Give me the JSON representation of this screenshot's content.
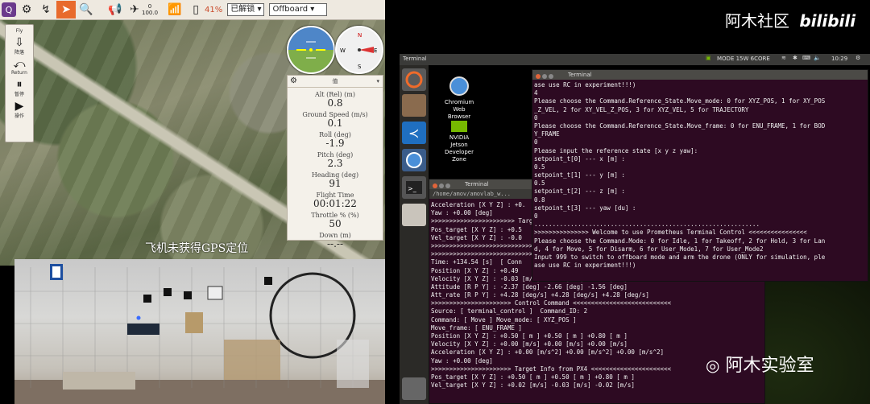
{
  "qgc": {
    "toolbar": {
      "gps_count": "0",
      "hdop": "100.0",
      "battery": "41%",
      "arm_state": "已解锁",
      "flight_mode": "Offboard"
    },
    "fly_tools": [
      {
        "label": "Fly",
        "icon": "plane-icon"
      },
      {
        "label": "降落",
        "icon": "land-icon"
      },
      {
        "label": "Return",
        "icon": "return-icon"
      },
      {
        "label": "暂停",
        "icon": "pause-icon"
      },
      {
        "label": "操作",
        "icon": "action-icon"
      }
    ],
    "values_panel": {
      "header": "值",
      "items": [
        {
          "label": "Alt (Rel) (m)",
          "value": "0.8"
        },
        {
          "label": "Ground Speed (m/s)",
          "value": "0.1"
        },
        {
          "label": "Roll (deg)",
          "value": "-1.9"
        },
        {
          "label": "Pitch (deg)",
          "value": "2.3"
        },
        {
          "label": "Heading (deg)",
          "value": "91"
        },
        {
          "label": "Flight Time",
          "value": "00:01:22"
        },
        {
          "label": "Throttle % (%)",
          "value": "50"
        },
        {
          "label": "Down (m)",
          "value": "--.--"
        }
      ]
    },
    "compass": {
      "n": "N",
      "e": "E",
      "s": "S",
      "w": "W"
    },
    "gps_message": "飞机未获得GPS定位"
  },
  "desktop": {
    "topbar": {
      "title": "Terminal",
      "mode": "MODE 15W 6CORE",
      "time": "10:29"
    },
    "icons": [
      {
        "label": "Chromium\nWeb\nBrowser"
      },
      {
        "label": "NVIDIA\nJetson\nDeveloper\nZone"
      }
    ],
    "small_terminal": {
      "title": "Terminal",
      "path": "/home/amov/amovlab_w...",
      "lines": [
        "Acceleration [X Y Z] : +0.",
        "Yaw : +0.00 [deg]",
        ">>>>>>>>>>>>>>>>>>>>>>> Targ",
        "Pos_target [X Y Z] : +0.5",
        "Vel_target [X Y Z] : -0.0",
        ">>>>>>>>>>>>>>>>>>>>>>>>>>>>",
        ">>>>>>>>>>>>>>>>>>>>>>>>>>>>",
        "Time: +134.54 [s]  [ Conn",
        "Position [X Y Z] : +0.49",
        "Velocity [X Y Z] : -0.03 [m/s] +0.10 [m/s] -0.00 [m/s]",
        "Attitude [R P Y] : -2.37 [deg] -2.66 [deg] -1.56 [deg]",
        "Att_rate [R P Y] : +4.28 [deg/s] +4.28 [deg/s] +4.28 [deg/s]",
        ">>>>>>>>>>>>>>>>>>>>>> Control Command <<<<<<<<<<<<<<<<<<<<<<<<<<<",
        "Source: [ terminal_control ]  Command_ID: 2",
        "Command: [ Move ] Move_mode: [ XYZ_POS ]",
        "Move_frame: [ ENU_FRAME ]",
        "Position [X Y Z] : +0.50 [ m ] +0.50 [ m ] +0.80 [ m ]",
        "Velocity [X Y Z] : +0.00 [m/s] +0.00 [m/s] +0.00 [m/s]",
        "Acceleration [X Y Z] : +0.00 [m/s^2] +0.00 [m/s^2] +0.00 [m/s^2]",
        "Yaw : +0.00 [deg]",
        ">>>>>>>>>>>>>>>>>>>>>> Target Info from PX4 <<<<<<<<<<<<<<<<<<<<<<",
        "Pos_target [X Y Z] : +0.50 [ m ] +0.50 [ m ] +0.80 [ m ]",
        "Vel_target [X Y Z] : +0.02 [m/s] -0.03 [m/s] -0.02 [m/s]"
      ]
    },
    "main_terminal": {
      "title": "Terminal",
      "lines": [
        "ase use RC in experiment!!!)",
        "4",
        "Please choose the Command.Reference_State.Move_mode: 0 for XYZ_POS, 1 for XY_POS",
        "_Z_VEL, 2 for XY_VEL_Z_POS, 3 for XYZ_VEL, 5 for TRAJECTORY",
        "0",
        "Please choose the Command.Reference_State.Move_frame: 0 for ENU_FRAME, 1 for BOD",
        "Y_FRAME",
        "0",
        "Please input the reference state [x y z yaw]:",
        "setpoint_t[0] --- x [m] :",
        "0.5",
        "setpoint_t[1] --- y [m] :",
        "0.5",
        "setpoint_t[2] --- z [m] :",
        "0.8",
        "setpoint_t[3] --- yaw [du] :",
        "0",
        "..............................................................",
        ">>>>>>>>>>>>>>> Welcome to use Prometheus Terminal Control <<<<<<<<<<<<<<<<",
        "Please choose the Command.Mode: 0 for Idle, 1 for Takeoff, 2 for Hold, 3 for Lan",
        "d, 4 for Move, 5 for Disarm, 6 for User_Mode1, 7 for User_Mode2",
        "Input 999 to switch to offboard mode and arm the drone (ONLY for simulation, ple",
        "ase use RC in experiment!!!)"
      ]
    }
  },
  "watermark": {
    "top": "阿木社区",
    "bili": "bilibili",
    "bottom": "阿木实验室"
  }
}
